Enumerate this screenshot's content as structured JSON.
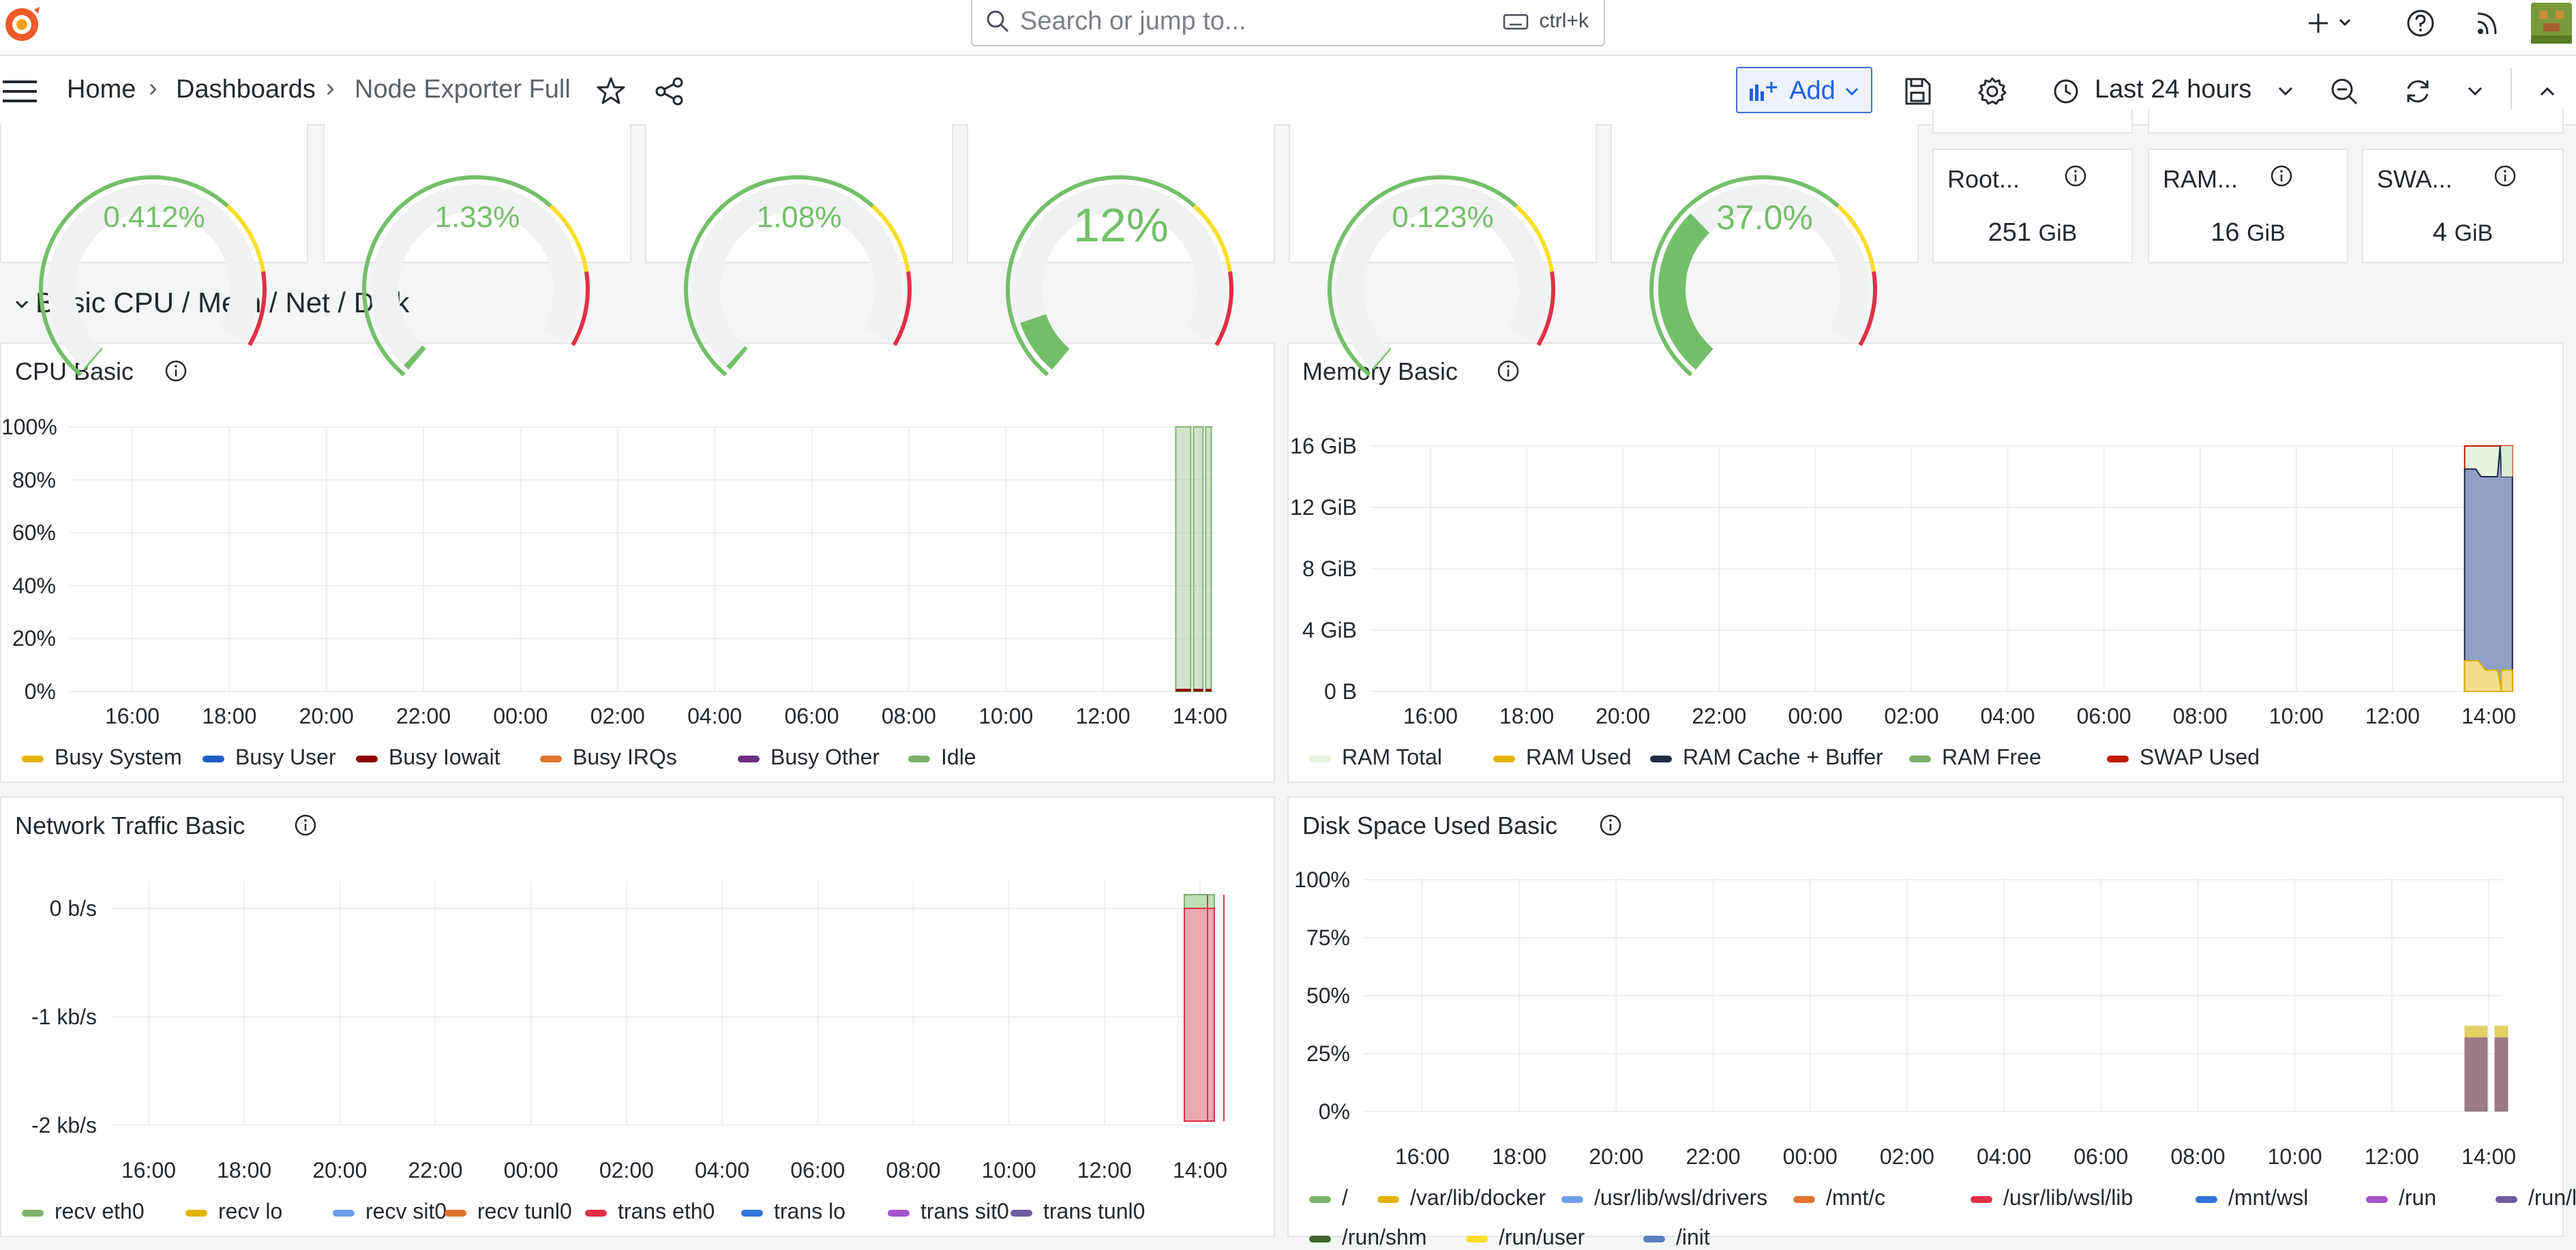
{
  "header": {
    "search_placeholder": "Search or jump to...",
    "search_shortcut": "ctrl+k"
  },
  "breadcrumb": {
    "home": "Home",
    "dashboards": "Dashboards",
    "current": "Node Exporter Full"
  },
  "toolbar": {
    "add_label": "Add",
    "time_range": "Last 24 hours"
  },
  "colors": {
    "green": "#73bf69",
    "yellow": "#fade2a",
    "red": "#e02f44",
    "blue": "#1f60c4",
    "accent": "#1f62e0"
  },
  "gauges": [
    {
      "value": "0.412%",
      "fraction": 0.00412
    },
    {
      "value": "1.33%",
      "fraction": 0.0133
    },
    {
      "value": "1.08%",
      "fraction": 0.0108
    },
    {
      "value": "12%",
      "fraction": 0.12
    },
    {
      "value": "0.123%",
      "fraction": 0.00123
    },
    {
      "value": "37.0%",
      "fraction": 0.37
    }
  ],
  "stats": [
    {
      "title": "Root...",
      "value": "251",
      "unit": "GiB"
    },
    {
      "title": "RAM...",
      "value": "16",
      "unit": "GiB"
    },
    {
      "title": "SWA...",
      "value": "4",
      "unit": "GiB"
    }
  ],
  "row": {
    "title": "Basic CPU / Mem / Net / Disk"
  },
  "panels": {
    "cpu": {
      "title": "CPU Basic"
    },
    "memory": {
      "title": "Memory Basic"
    },
    "network": {
      "title": "Network Traffic Basic"
    },
    "disk": {
      "title": "Disk Space Used Basic"
    }
  },
  "chart_data": [
    {
      "type": "area",
      "title": "CPU Basic",
      "x_ticks": [
        "16:00",
        "18:00",
        "20:00",
        "22:00",
        "00:00",
        "02:00",
        "04:00",
        "06:00",
        "08:00",
        "10:00",
        "12:00",
        "14:00"
      ],
      "y_ticks": [
        "0%",
        "20%",
        "40%",
        "60%",
        "80%",
        "100%"
      ],
      "ylim": [
        0,
        100
      ],
      "series": [
        {
          "name": "Busy System",
          "color": "#e0b400"
        },
        {
          "name": "Busy User",
          "color": "#1f60c4"
        },
        {
          "name": "Busy Iowait",
          "color": "#8f0000"
        },
        {
          "name": "Busy IRQs",
          "color": "#e0752d"
        },
        {
          "name": "Busy Other",
          "color": "#6e2e82"
        },
        {
          "name": "Idle",
          "color": "#7eb26d"
        }
      ],
      "notes_visible": "data only present around 13:30-14:00, Idle near 100%"
    },
    {
      "type": "area",
      "title": "Memory Basic",
      "x_ticks": [
        "16:00",
        "18:00",
        "20:00",
        "22:00",
        "00:00",
        "02:00",
        "04:00",
        "06:00",
        "08:00",
        "10:00",
        "12:00",
        "14:00"
      ],
      "y_ticks": [
        "0 B",
        "4 GiB",
        "8 GiB",
        "12 GiB",
        "16 GiB"
      ],
      "ylim": [
        0,
        16
      ],
      "series": [
        {
          "name": "RAM Total",
          "color": "#e6f4de",
          "values": [
            16,
            16
          ]
        },
        {
          "name": "RAM Used",
          "color": "#e0b400",
          "values": [
            2,
            1.4
          ]
        },
        {
          "name": "RAM Cache + Buffer",
          "color": "#1f2a44",
          "values": [
            14.5,
            14
          ]
        },
        {
          "name": "RAM Free",
          "color": "#7eb26d",
          "values": [
            1.4,
            1.9
          ]
        },
        {
          "name": "SWAP Used",
          "color": "#bf1b00",
          "values": [
            0,
            0
          ]
        }
      ]
    },
    {
      "type": "area",
      "title": "Network Traffic Basic",
      "x_ticks": [
        "16:00",
        "18:00",
        "20:00",
        "22:00",
        "00:00",
        "02:00",
        "04:00",
        "06:00",
        "08:00",
        "10:00",
        "12:00",
        "14:00"
      ],
      "y_ticks": [
        "0 b/s",
        "-1 kb/s",
        "-2 kb/s"
      ],
      "ylim": [
        -2,
        0
      ],
      "series": [
        {
          "name": "recv eth0",
          "color": "#7eb26d"
        },
        {
          "name": "recv lo",
          "color": "#e0b400"
        },
        {
          "name": "recv sit0",
          "color": "#6d9eeb"
        },
        {
          "name": "recv tunl0",
          "color": "#e0752d"
        },
        {
          "name": "trans eth0",
          "color": "#e02f44"
        },
        {
          "name": "trans lo",
          "color": "#3274d9"
        },
        {
          "name": "trans sit0",
          "color": "#a352cc"
        },
        {
          "name": "trans tunl0",
          "color": "#705da0"
        }
      ]
    },
    {
      "type": "area",
      "title": "Disk Space Used Basic",
      "x_ticks": [
        "16:00",
        "18:00",
        "20:00",
        "22:00",
        "00:00",
        "02:00",
        "04:00",
        "06:00",
        "08:00",
        "10:00",
        "12:00",
        "14:00"
      ],
      "y_ticks": [
        "0%",
        "25%",
        "50%",
        "75%",
        "100%"
      ],
      "ylim": [
        0,
        100
      ],
      "series": [
        {
          "name": "/",
          "color": "#7eb26d"
        },
        {
          "name": "/var/lib/docker",
          "color": "#e0b400",
          "values": [
            37,
            37
          ]
        },
        {
          "name": "/usr/lib/wsl/drivers",
          "color": "#6d9eeb"
        },
        {
          "name": "/mnt/c",
          "color": "#e0752d"
        },
        {
          "name": "/usr/lib/wsl/lib",
          "color": "#e02f44"
        },
        {
          "name": "/mnt/wsl",
          "color": "#3274d9"
        },
        {
          "name": "/run",
          "color": "#a352cc"
        },
        {
          "name": "/run/lock",
          "color": "#705da0",
          "values": [
            32,
            32
          ]
        },
        {
          "name": "/run/shm",
          "color": "#3f6833"
        },
        {
          "name": "/run/user",
          "color": "#fade2a"
        },
        {
          "name": "/init",
          "color": "#5b7fbf"
        }
      ]
    }
  ]
}
